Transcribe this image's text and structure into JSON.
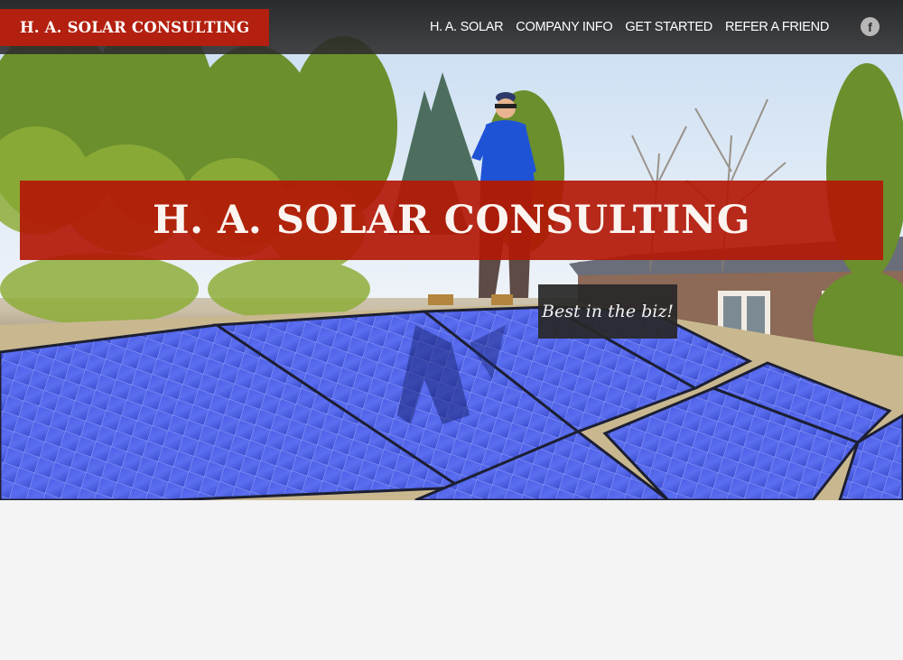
{
  "header": {
    "brand": "H. A. SOLAR CONSULTING",
    "nav": [
      {
        "label": "H. A. SOLAR"
      },
      {
        "label": "COMPANY INFO"
      },
      {
        "label": "GET STARTED"
      },
      {
        "label": "REFER A FRIEND"
      }
    ],
    "social_icon": "facebook-icon",
    "social_glyph": "f"
  },
  "hero": {
    "title": "H. A. SOLAR CONSULTING",
    "tagline": "Best in the biz!",
    "image": "person-on-roof-with-solar-panels"
  },
  "colors": {
    "brand_red": "#b3200f",
    "header_bg": "#2a2a2a",
    "tagline_bg": "#282828",
    "page_bg": "#f4f4f4"
  }
}
